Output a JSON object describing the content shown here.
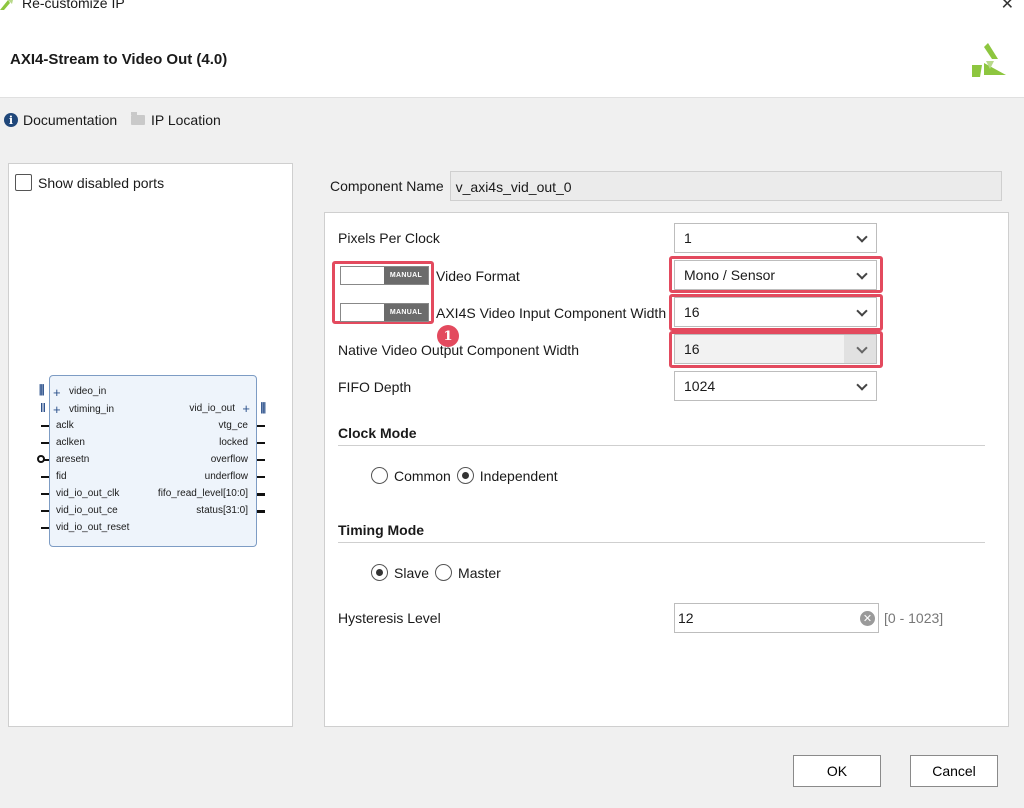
{
  "window": {
    "title": "Re-customize IP",
    "close": "✕"
  },
  "header": {
    "ip_title": "AXI4-Stream to Video Out (4.0)"
  },
  "links": {
    "documentation": "Documentation",
    "ip_location": "IP Location"
  },
  "left": {
    "show_disabled_ports": "Show disabled ports",
    "block": {
      "left_buses": [
        "video_in",
        "vtiming_in"
      ],
      "left_ports": [
        "aclk",
        "aclken",
        "aresetn",
        "fid",
        "vid_io_out_clk",
        "vid_io_out_ce",
        "vid_io_out_reset"
      ],
      "right_bus": "vid_io_out",
      "right_ports": [
        "vtg_ce",
        "locked",
        "overflow",
        "underflow",
        "fifo_read_level[10:0]",
        "status[31:0]"
      ]
    }
  },
  "component": {
    "label": "Component Name",
    "value": "v_axi4s_vid_out_0"
  },
  "params": {
    "pixels_per_clock": {
      "label": "Pixels Per Clock",
      "value": "1"
    },
    "video_format": {
      "label": "Video Format",
      "value": "Mono / Sensor"
    },
    "input_width": {
      "label": "AXI4S Video Input Component Width",
      "value": "16"
    },
    "output_width": {
      "label": "Native Video Output Component Width",
      "value": "16"
    },
    "fifo_depth": {
      "label": "FIFO Depth",
      "value": "1024"
    },
    "manual_label": "MANUAL",
    "badge": "1"
  },
  "clock_mode": {
    "title": "Clock Mode",
    "options": [
      "Common",
      "Independent"
    ],
    "selected": "Independent"
  },
  "timing_mode": {
    "title": "Timing Mode",
    "options": [
      "Slave",
      "Master"
    ],
    "selected": "Slave"
  },
  "hysteresis": {
    "label": "Hysteresis Level",
    "value": "12",
    "range": "[0 - 1023]"
  },
  "buttons": {
    "ok": "OK",
    "cancel": "Cancel"
  },
  "colors": {
    "highlight": "#e34a5e",
    "logo": "#8dc63f"
  }
}
